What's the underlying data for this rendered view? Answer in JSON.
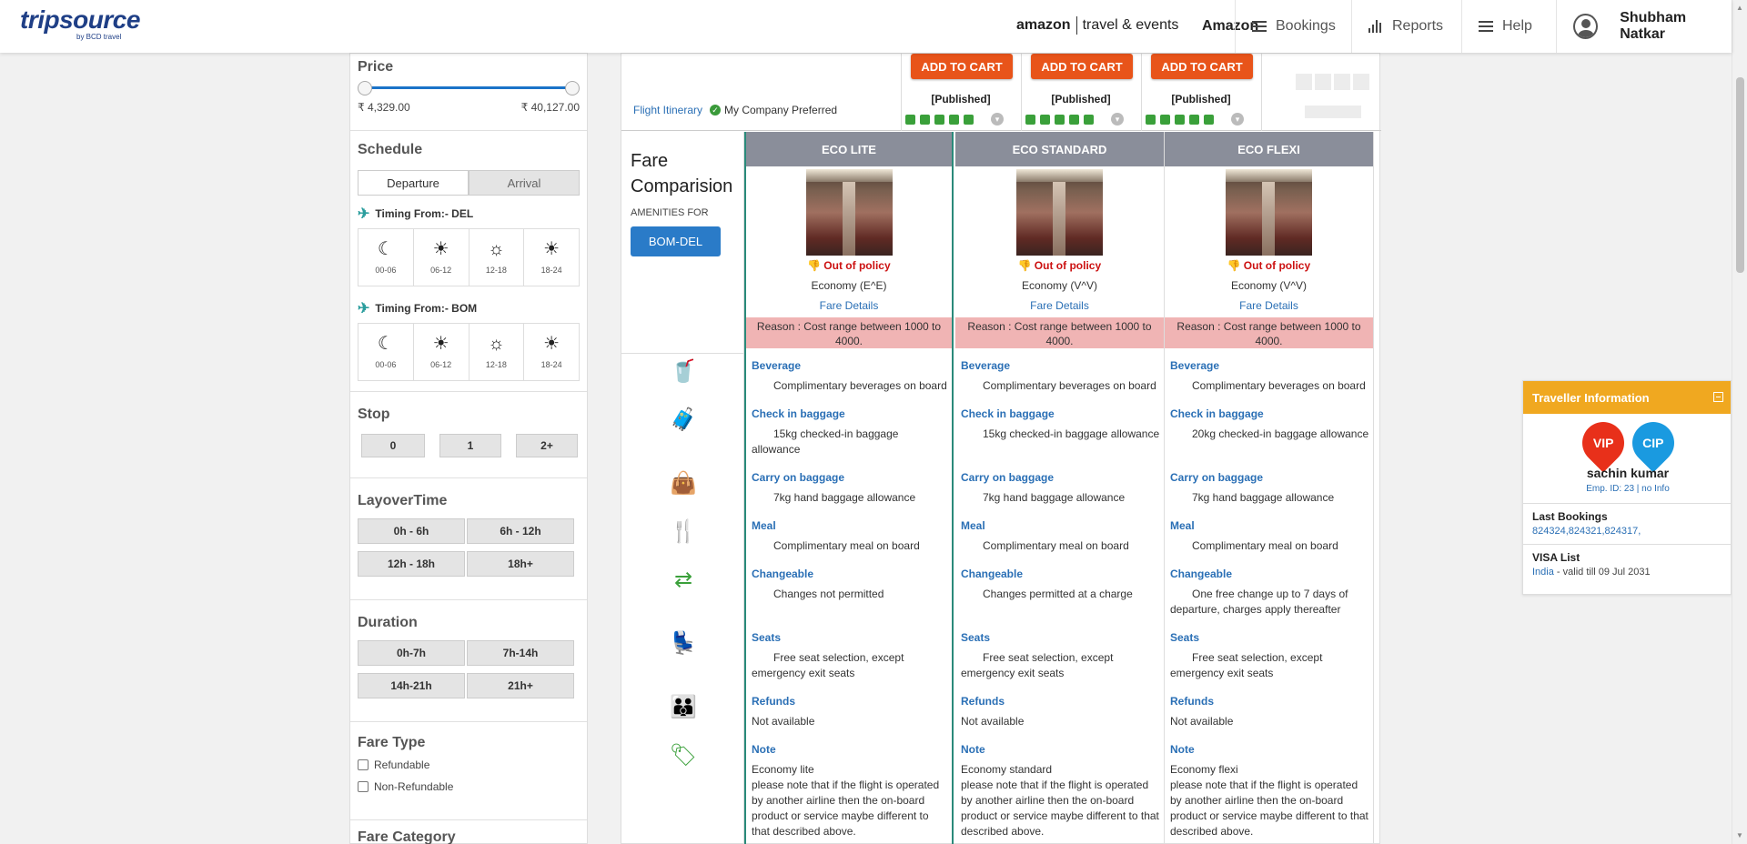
{
  "header": {
    "logo_main": "tripsource",
    "logo_sub": "by BCD travel",
    "amazon_brand": "amazon",
    "amazon_tag": "travel & events",
    "company": "Amazon",
    "nav": [
      {
        "label": "Bookings",
        "icon": "hamburger-icon"
      },
      {
        "label": "Reports",
        "icon": "bar-chart-icon"
      },
      {
        "label": "Help",
        "icon": "hamburger-icon"
      }
    ],
    "user_name": "Shubham Natkar"
  },
  "sidebar": {
    "price": {
      "title": "Price",
      "min": "₹ 4,329.00",
      "max": "₹ 40,127.00"
    },
    "schedule": {
      "title": "Schedule",
      "tabs": [
        "Departure",
        "Arrival"
      ],
      "timing_del": "Timing From:- DEL",
      "timing_bom": "Timing From:- BOM",
      "slots": [
        "00-06",
        "06-12",
        "12-18",
        "18-24"
      ]
    },
    "stop": {
      "title": "Stop",
      "options": [
        "0",
        "1",
        "2+"
      ]
    },
    "layover": {
      "title": "LayoverTime",
      "options": [
        "0h - 6h",
        "6h - 12h",
        "12h - 18h",
        "18h+"
      ]
    },
    "duration": {
      "title": "Duration",
      "options": [
        "0h-7h",
        "7h-14h",
        "14h-21h",
        "21h+"
      ]
    },
    "fare_type": {
      "title": "Fare Type",
      "options": [
        "Refundable",
        "Non-Refundable"
      ]
    },
    "fare_category": {
      "title": "Fare Category"
    }
  },
  "top": {
    "itinerary_link": "Flight Itinerary",
    "preferred": "My Company Preferred",
    "cart_label": "ADD TO CART",
    "published": "[Published]"
  },
  "fare": {
    "title_line1": "Fare",
    "title_line2": "Comparision",
    "amenities_for": "AMENITIES FOR",
    "route": "BOM-DEL",
    "out_of_policy": "Out of policy",
    "fare_details": "Fare Details",
    "reason": "Reason : Cost range between 1000 to 4000.",
    "labels": {
      "beverage": "Beverage",
      "checkin": "Check in baggage",
      "carry": "Carry on baggage",
      "meal": "Meal",
      "changeable": "Changeable",
      "seats": "Seats",
      "refunds": "Refunds",
      "note": "Note"
    },
    "columns": [
      {
        "name": "ECO LITE",
        "class": "Economy (E^E)",
        "beverage": "Complimentary beverages on board",
        "checkin": "15kg checked-in baggage allowance",
        "carry": "7kg hand baggage allowance",
        "meal": "Complimentary meal on board",
        "changeable": "Changes not permitted",
        "seats": "Free seat selection, except emergency exit seats",
        "refunds": "Not available",
        "note": "Economy lite\n please note that if the flight is operated by another airline then the on-board product or service maybe different to that described above."
      },
      {
        "name": "ECO STANDARD",
        "class": "Economy (V^V)",
        "beverage": "Complimentary beverages on board",
        "checkin": "15kg checked-in baggage allowance",
        "carry": "7kg hand baggage allowance",
        "meal": "Complimentary meal on board",
        "changeable": "Changes permitted at a charge",
        "seats": "Free seat selection, except emergency exit seats",
        "refunds": "Not available",
        "note": "Economy standard\n please note that if the flight is operated by another airline then the on-board product or service maybe different to that described above."
      },
      {
        "name": "ECO FLEXI",
        "class": "Economy (V^V)",
        "beverage": "Complimentary beverages on board",
        "checkin": "20kg checked-in baggage allowance",
        "carry": "7kg hand baggage allowance",
        "meal": "Complimentary meal on board",
        "changeable": "One free change up to 7 days of departure, charges apply thereafter",
        "seats": "Free seat selection, except emergency exit seats",
        "refunds": "Not available",
        "note": "Economy flexi\n please note that if the flight is operated by another airline then the on-board product or service maybe different to that described above."
      }
    ]
  },
  "traveller": {
    "title": "Traveller Information",
    "badge_vip": "VIP",
    "badge_cip": "CIP",
    "name": "sachin kumar",
    "emp": "Emp. ID: 23 | no Info",
    "last_bookings_title": "Last Bookings",
    "last_bookings": "824324,824321,824317,",
    "visa_title": "VISA List",
    "visa_country": "India",
    "visa_valid": " - valid till 09 Jul 2031"
  },
  "colors": {
    "brand": "#1f3f86",
    "cart": "#e8541a",
    "route": "#2a7bc8",
    "accent": "#3aa03a",
    "panel": "#f0a820",
    "vip": "#e8301a",
    "cip": "#1a9ae0"
  }
}
